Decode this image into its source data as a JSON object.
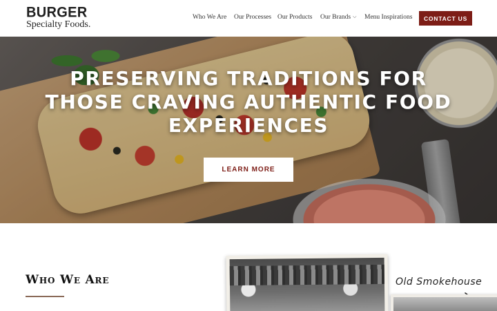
{
  "brand": {
    "logo_line1": "BURGER",
    "logo_line2": "Specialty Foods.",
    "accent_color": "#7d1d16"
  },
  "nav": {
    "items": [
      {
        "label": "Who We Are"
      },
      {
        "label": "Our Processes"
      },
      {
        "label": "Our Products"
      },
      {
        "label": "Our Brands",
        "has_dropdown": true
      },
      {
        "label": "Menu Inspirations"
      }
    ],
    "dropdown_icon": "chevron-down-icon",
    "contact_label": "CONTACT US"
  },
  "hero": {
    "title": "PRESERVING TRADITIONS FOR THOSE CRAVING AUTHENTIC FOOD EXPERIENCES",
    "button_label": "LEARN MORE"
  },
  "who": {
    "title": "Who We Are",
    "script_caption": "Old Smokehouse"
  }
}
